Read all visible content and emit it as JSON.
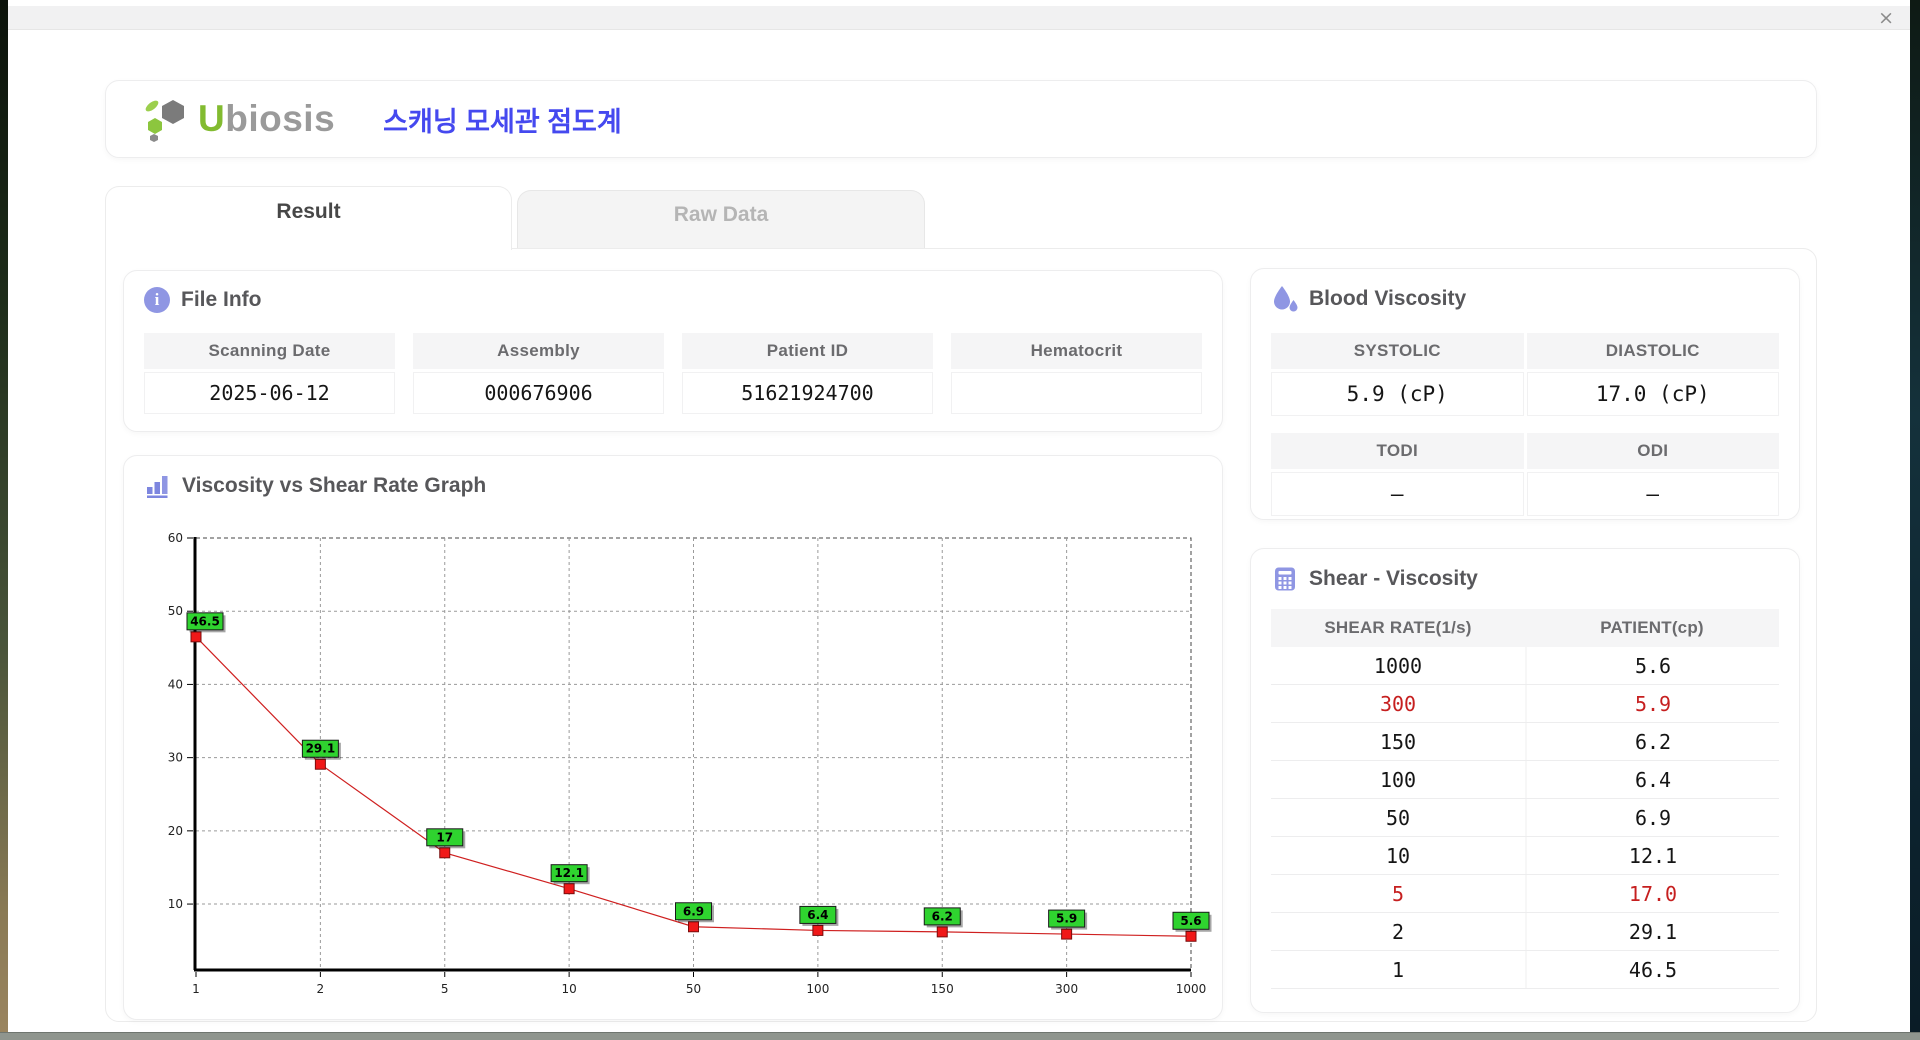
{
  "window": {
    "close_glyph": "×"
  },
  "header": {
    "brand_u": "U",
    "brand_rest": "biosis",
    "title_ko": "스캐닝 모세관 점도계"
  },
  "tabs": [
    {
      "label": "Result",
      "active": true
    },
    {
      "label": "Raw Data",
      "active": false
    }
  ],
  "file_info": {
    "title": "File Info",
    "fields": [
      {
        "label": "Scanning Date",
        "value": "2025-06-12"
      },
      {
        "label": "Assembly",
        "value": "000676906"
      },
      {
        "label": "Patient ID",
        "value": "51621924700"
      },
      {
        "label": "Hematocrit",
        "value": ""
      }
    ]
  },
  "blood_viscosity": {
    "title": "Blood Viscosity",
    "cells": [
      {
        "label": "SYSTOLIC",
        "value": "5.9 (cP)"
      },
      {
        "label": "DIASTOLIC",
        "value": "17.0 (cP)"
      },
      {
        "label": "TODI",
        "value": "–"
      },
      {
        "label": "ODI",
        "value": "–"
      }
    ]
  },
  "graph": {
    "title": "Viscosity vs Shear Rate Graph"
  },
  "chart_data": {
    "type": "line",
    "title": "Viscosity vs Shear Rate Graph",
    "x_categories": [
      "1",
      "2",
      "5",
      "10",
      "50",
      "100",
      "150",
      "300",
      "1000"
    ],
    "values": [
      46.5,
      29.1,
      17,
      12.1,
      6.9,
      6.4,
      6.2,
      5.9,
      5.6
    ],
    "point_labels": [
      "46.5",
      "29.1",
      "17",
      "12.1",
      "6.9",
      "6.4",
      "6.2",
      "5.9",
      "5.6"
    ],
    "xlabel": "",
    "ylabel": "",
    "ylim": [
      0,
      60
    ],
    "y_ticks": [
      10,
      20,
      30,
      40,
      50,
      60
    ],
    "grid": "dashed",
    "line_color": "#cf2020",
    "marker_fill": "#f01818",
    "marker_stroke": "#7a0d0d",
    "label_bg": "#2fd32f",
    "label_border": "#1a1a1a",
    "grid_color": "#9a9a9a",
    "axis_color": "#000000"
  },
  "shear_table": {
    "title": "Shear - Viscosity",
    "columns": [
      "SHEAR RATE(1/s)",
      "PATIENT(cp)"
    ],
    "rows": [
      {
        "shear": "1000",
        "patient": "5.6",
        "highlight": false
      },
      {
        "shear": "300",
        "patient": "5.9",
        "highlight": true
      },
      {
        "shear": "150",
        "patient": "6.2",
        "highlight": false
      },
      {
        "shear": "100",
        "patient": "6.4",
        "highlight": false
      },
      {
        "shear": "50",
        "patient": "6.9",
        "highlight": false
      },
      {
        "shear": "10",
        "patient": "12.1",
        "highlight": false
      },
      {
        "shear": "5",
        "patient": "17.0",
        "highlight": true
      },
      {
        "shear": "2",
        "patient": "29.1",
        "highlight": false
      },
      {
        "shear": "1",
        "patient": "46.5",
        "highlight": false
      }
    ]
  },
  "accent_colors": {
    "icon_purple": "#8f96e3",
    "title_blue": "#4549ef",
    "logo_green": "#82bb30",
    "highlight_red": "#c61f1f"
  }
}
